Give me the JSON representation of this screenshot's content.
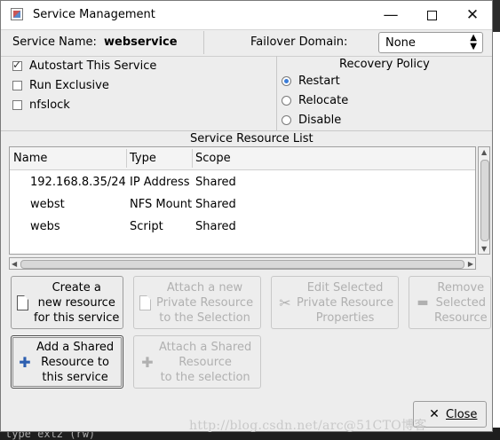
{
  "window": {
    "title": "Service Management",
    "controls": {
      "minimize": "—",
      "close": "✕"
    }
  },
  "service": {
    "name_label": "Service Name:",
    "name_value": "webservice",
    "failover_label": "Failover Domain:",
    "failover_value": "None"
  },
  "options": [
    {
      "label": "Autostart This Service",
      "checked": true
    },
    {
      "label": "Run Exclusive",
      "checked": false
    },
    {
      "label": "nfslock",
      "checked": false
    }
  ],
  "recovery": {
    "title": "Recovery Policy",
    "choices": [
      {
        "label": "Restart",
        "selected": true
      },
      {
        "label": "Relocate",
        "selected": false
      },
      {
        "label": "Disable",
        "selected": false
      }
    ]
  },
  "resource_list": {
    "title": "Service Resource List",
    "columns": [
      "Name",
      "Type",
      "Scope"
    ],
    "rows": [
      [
        "192.168.8.35/24",
        "IP Address",
        "Shared"
      ],
      [
        "webst",
        "NFS Mount",
        "Shared"
      ],
      [
        "webs",
        "Script",
        "Shared"
      ]
    ]
  },
  "buttons": {
    "create": "Create a\nnew resource\nfor this service",
    "add_shared": "Add a Shared\nResource to\nthis service",
    "attach_private": "Attach a new\nPrivate Resource\nto the Selection",
    "attach_shared": "Attach a Shared\nResource\nto the selection",
    "edit_selected": "Edit Selected\nPrivate Resource\nProperties",
    "remove_selected": "Remove\nSelected\nResource",
    "close": "Close"
  },
  "watermark": "http://blog.csdn.net/arc@51CTO博客",
  "background": {
    "terminal_line": "type ext2 (rw)"
  }
}
